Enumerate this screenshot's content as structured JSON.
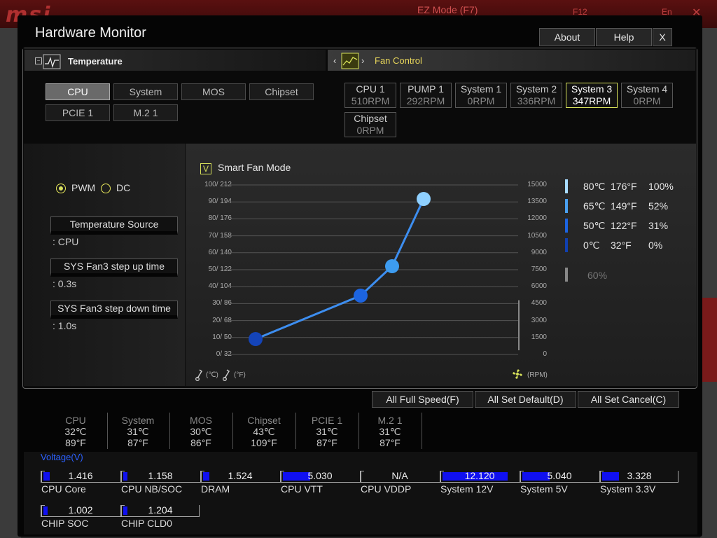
{
  "background": {
    "logo": "msi",
    "ez_mode": "EZ Mode (F7)",
    "f12": "F12",
    "lang": "En",
    "close": "✕"
  },
  "dialog": {
    "title": "Hardware Monitor",
    "about": "About",
    "help": "Help",
    "close": "X"
  },
  "temperature": {
    "section_label": "Temperature",
    "sources": [
      "CPU",
      "System",
      "MOS",
      "Chipset",
      "PCIE 1",
      "M.2 1"
    ],
    "selected": "CPU"
  },
  "fan_control": {
    "section_label": "Fan Control",
    "fans": [
      {
        "name": "CPU 1",
        "rpm": "510RPM"
      },
      {
        "name": "PUMP 1",
        "rpm": "292RPM"
      },
      {
        "name": "System 1",
        "rpm": "0RPM"
      },
      {
        "name": "System 2",
        "rpm": "336RPM"
      },
      {
        "name": "System 3",
        "rpm": "347RPM"
      },
      {
        "name": "System 4",
        "rpm": "0RPM"
      },
      {
        "name": "Chipset",
        "rpm": "0RPM"
      }
    ],
    "selected": "System 3"
  },
  "settings": {
    "pwm": "PWM",
    "dc": "DC",
    "mode_selected": "PWM",
    "temp_source_label": "Temperature Source",
    "temp_source_value": ": CPU",
    "step_up_label": "SYS Fan3 step up time",
    "step_up_value": ": 0.3s",
    "step_down_label": "SYS Fan3 step down time",
    "step_down_value": ": 1.0s"
  },
  "smart_fan": {
    "checked": true,
    "check_mark": "V",
    "label": "Smart Fan Mode"
  },
  "chart_data": {
    "type": "line",
    "y_left_ticks": [
      "100/ 212",
      "90/ 194",
      "80/ 176",
      "70/ 158",
      "60/ 140",
      "50/ 122",
      "40/ 104",
      "30/  86",
      "20/  68",
      "10/  50",
      "0/  32"
    ],
    "y_right_ticks": [
      "15000",
      "13500",
      "12000",
      "10500",
      "9000",
      "7500",
      "6000",
      "4500",
      "3000",
      "1500",
      "0"
    ],
    "x_unit_left": "(℃)",
    "x_unit_left_f": "(°F)",
    "x_unit_right": "(RPM)",
    "series": [
      {
        "values": [
          [
            0,
            0
          ],
          [
            50,
            31
          ],
          [
            65,
            52
          ],
          [
            80,
            100
          ]
        ]
      }
    ],
    "point_colors": [
      "#1444b8",
      "#1c64e0",
      "#3d9cf0",
      "#8fd0ff"
    ]
  },
  "legend": {
    "rows": [
      {
        "c": "80℃",
        "f": "176°F",
        "p": "100%",
        "color": "#a8dcff"
      },
      {
        "c": "65℃",
        "f": "149°F",
        "p": "52%",
        "color": "#4aa0f0"
      },
      {
        "c": "50℃",
        "f": "122°F",
        "p": "31%",
        "color": "#1c64e0"
      },
      {
        "c": "0℃",
        "f": "32°F",
        "p": "0%",
        "color": "#1040b0"
      }
    ],
    "min_label": "60%"
  },
  "actions": {
    "full_speed": "All Full Speed(F)",
    "set_default": "All Set Default(D)",
    "set_cancel": "All Set Cancel(C)"
  },
  "temps": [
    {
      "name": "CPU",
      "c": "32℃",
      "f": "89°F"
    },
    {
      "name": "System",
      "c": "31℃",
      "f": "87°F"
    },
    {
      "name": "MOS",
      "c": "30℃",
      "f": "86°F"
    },
    {
      "name": "Chipset",
      "c": "43℃",
      "f": "109°F"
    },
    {
      "name": "PCIE 1",
      "c": "31℃",
      "f": "87°F"
    },
    {
      "name": "M.2 1",
      "c": "31℃",
      "f": "87°F"
    }
  ],
  "voltage": {
    "title": "Voltage(V)",
    "items": [
      {
        "name": "CPU Core",
        "value": "1.416",
        "fill": 0.08
      },
      {
        "name": "CPU NB/SOC",
        "value": "1.158",
        "fill": 0.06
      },
      {
        "name": "DRAM",
        "value": "1.524",
        "fill": 0.08
      },
      {
        "name": "CPU VTT",
        "value": "5.030",
        "fill": 0.36
      },
      {
        "name": "CPU VDDP",
        "value": "N/A",
        "fill": 0
      },
      {
        "name": "System 12V",
        "value": "12.120",
        "fill": 0.86
      },
      {
        "name": "System 5V",
        "value": "5.040",
        "fill": 0.36
      },
      {
        "name": "System 3.3V",
        "value": "3.328",
        "fill": 0.22
      },
      {
        "name": "CHIP SOC",
        "value": "1.002",
        "fill": 0.06
      },
      {
        "name": "CHIP CLD0",
        "value": "1.204",
        "fill": 0.06
      }
    ]
  }
}
